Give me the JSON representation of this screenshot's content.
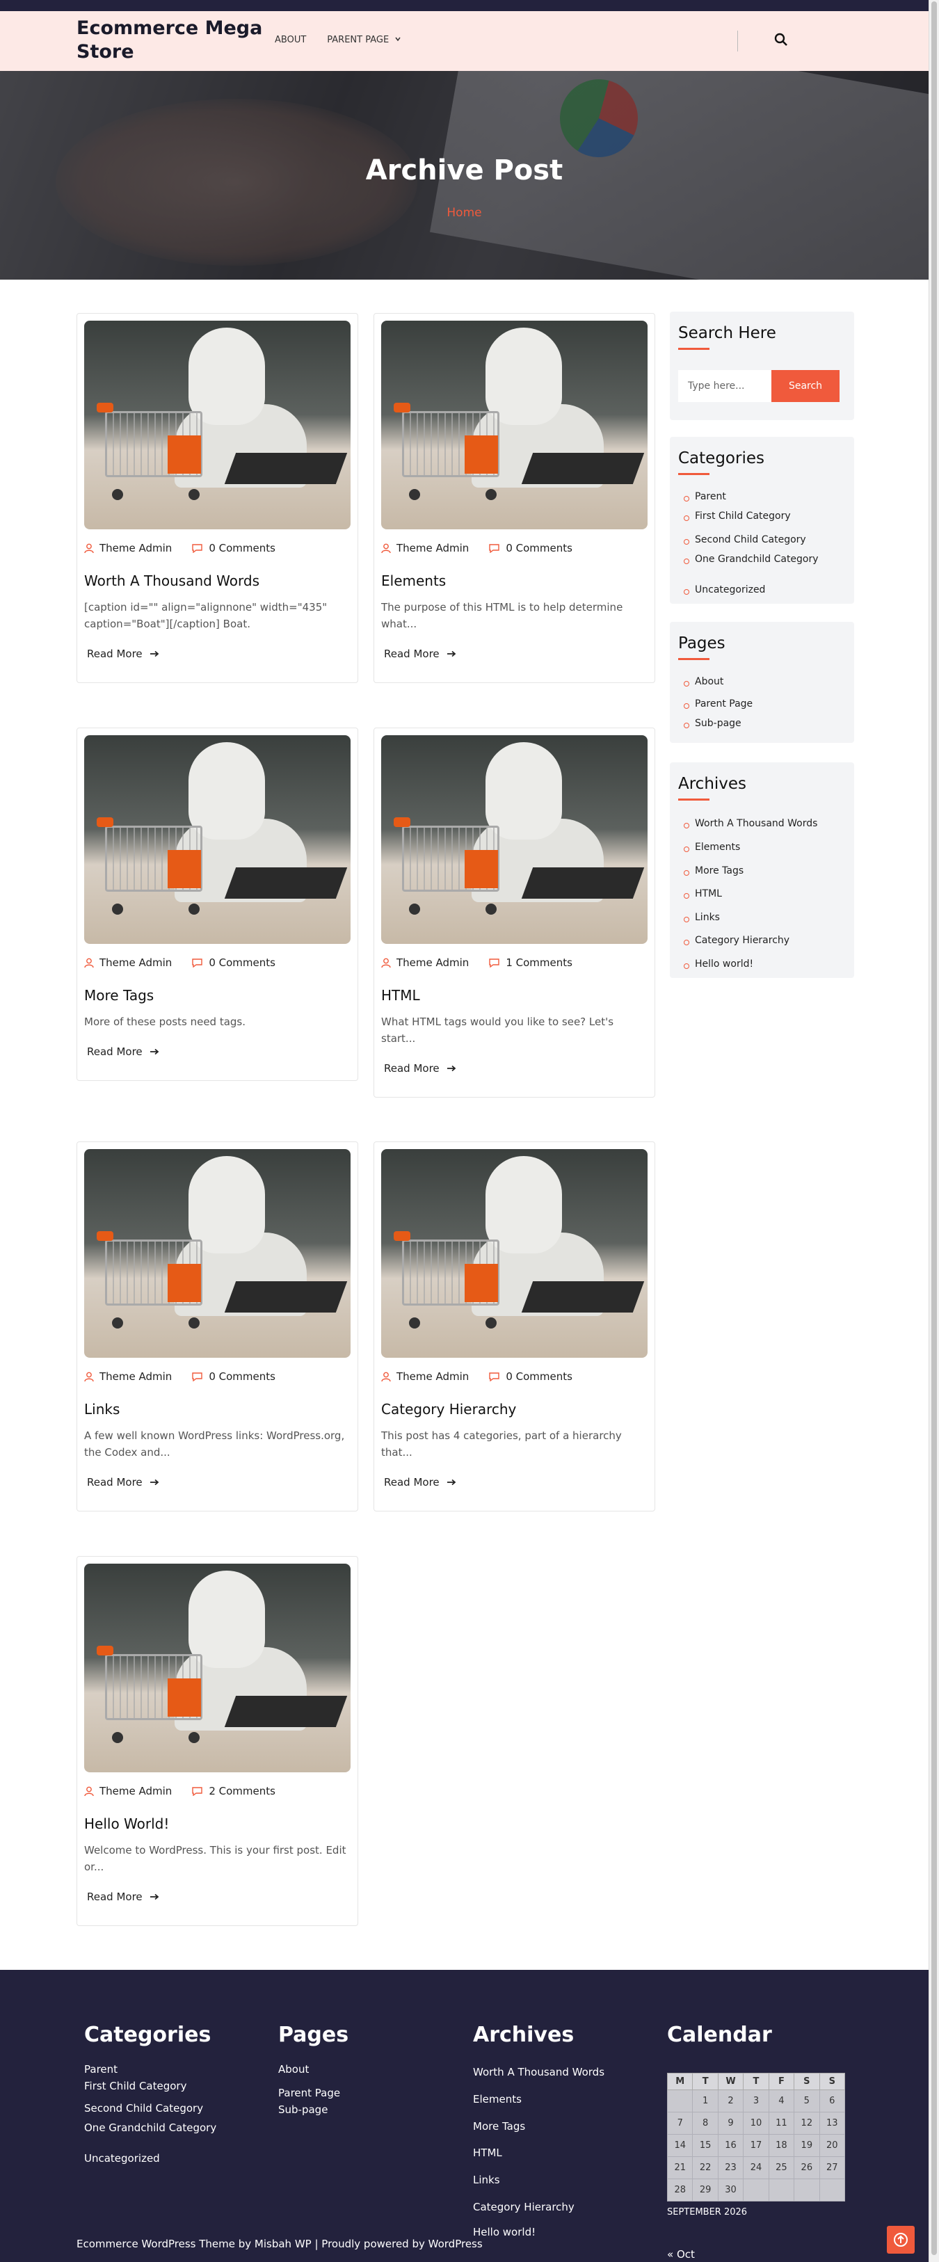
{
  "site": {
    "title": "Ecommerce Mega Store"
  },
  "nav": {
    "items": [
      "ABOUT",
      "PARENT PAGE"
    ]
  },
  "hero": {
    "title": "Archive Post",
    "breadcrumb": "Home"
  },
  "posts": [
    {
      "author": "Theme Admin",
      "comments": "0 Comments",
      "title": "Worth A Thousand Words",
      "excerpt": "[caption id=\"\" align=\"alignnone\" width=\"435\" caption=\"Boat\"][/caption] Boat.",
      "read_more": "Read More"
    },
    {
      "author": "Theme Admin",
      "comments": "0 Comments",
      "title": "Elements",
      "excerpt": "The purpose of this HTML is to help determine what...",
      "read_more": "Read More"
    },
    {
      "author": "Theme Admin",
      "comments": "0 Comments",
      "title": "More Tags",
      "excerpt": "More of these posts need tags.",
      "read_more": "Read More"
    },
    {
      "author": "Theme Admin",
      "comments": "1 Comments",
      "title": "HTML",
      "excerpt": "What HTML tags would you like to see? Let's start...",
      "read_more": "Read More"
    },
    {
      "author": "Theme Admin",
      "comments": "0 Comments",
      "title": "Links",
      "excerpt": "A few well known WordPress links: WordPress.org, the Codex and...",
      "read_more": "Read More"
    },
    {
      "author": "Theme Admin",
      "comments": "0 Comments",
      "title": "Category Hierarchy",
      "excerpt": "This post has 4 categories, part of a hierarchy that...",
      "read_more": "Read More"
    },
    {
      "author": "Theme Admin",
      "comments": "2 Comments",
      "title": "Hello World!",
      "excerpt": "Welcome to WordPress. This is your first post. Edit or...",
      "read_more": "Read More"
    }
  ],
  "sidebar": {
    "search": {
      "title": "Search Here",
      "placeholder": "Type here...",
      "button": "Search"
    },
    "categories": {
      "title": "Categories",
      "items": [
        "Parent",
        "First Child Category",
        "Second Child Category",
        "One Grandchild Category",
        "Uncategorized"
      ]
    },
    "pages": {
      "title": "Pages",
      "items": [
        "About",
        "Parent Page",
        "Sub-page"
      ]
    },
    "archives": {
      "title": "Archives",
      "items": [
        "Worth A Thousand Words",
        "Elements",
        "More Tags",
        "HTML",
        "Links",
        "Category Hierarchy",
        "Hello world!"
      ]
    }
  },
  "footer": {
    "categories": {
      "title": "Categories",
      "items": [
        "Parent",
        "First Child Category",
        "Second Child Category",
        "One Grandchild Category",
        "Uncategorized"
      ]
    },
    "pages": {
      "title": "Pages",
      "items": [
        "About",
        "Parent Page",
        "Sub-page"
      ]
    },
    "archives": {
      "title": "Archives",
      "items": [
        "Worth A Thousand Words",
        "Elements",
        "More Tags",
        "HTML",
        "Links",
        "Category Hierarchy",
        "Hello world!"
      ]
    },
    "calendar": {
      "title": "Calendar",
      "days": [
        "M",
        "T",
        "W",
        "T",
        "F",
        "S",
        "S"
      ],
      "weeks": [
        [
          "",
          "1",
          "2",
          "3",
          "4",
          "5",
          "6"
        ],
        [
          "7",
          "8",
          "9",
          "10",
          "11",
          "12",
          "13"
        ],
        [
          "14",
          "15",
          "16",
          "17",
          "18",
          "19",
          "20"
        ],
        [
          "21",
          "22",
          "23",
          "24",
          "25",
          "26",
          "27"
        ],
        [
          "28",
          "29",
          "30",
          "",
          "",
          "",
          ""
        ]
      ],
      "caption": "SEPTEMBER 2026",
      "prev": "« Oct"
    },
    "copyright": "Ecommerce WordPress Theme by Misbah WP | Proudly powered by WordPress"
  },
  "colors": {
    "accent": "#f05a3c",
    "dark": "#23223d",
    "header_bg": "#fde9e6"
  }
}
